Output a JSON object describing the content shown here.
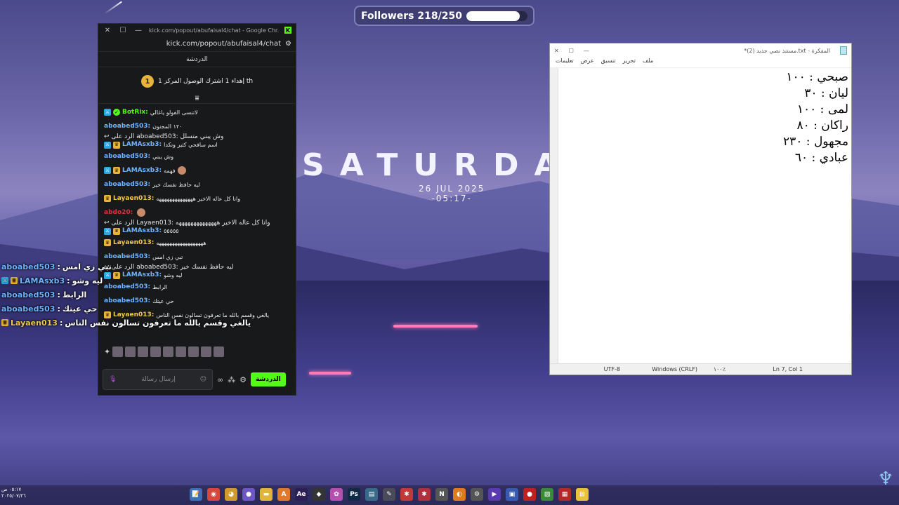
{
  "followers": {
    "label": "Followers 218/250",
    "current": 218,
    "goal": 250
  },
  "wallpaper": {
    "title": "SATURDA",
    "date": "26 JUL 2025",
    "time": "-05:17-"
  },
  "chat_window": {
    "title": "kick.com/popout/abufaisal4/chat - Google Chr...",
    "url": "kick.com/popout/abufaisal4/chat",
    "heading": "الدردشة",
    "pinned": {
      "rank": "1",
      "text": "إهداء 1 اشترك الوصول المركز 1 th"
    },
    "messages": [
      {
        "badges": [
          "mod",
          "verified"
        ],
        "user": "BotRix",
        "color": "#53fc18",
        "text": "لاتنسى الفولو ياغالي"
      },
      {
        "badges": [],
        "user": "aboabed503",
        "color": "#6fb3ff",
        "text": "١٢٠ المجنون"
      },
      {
        "badges": [
          "mod",
          "crown"
        ],
        "user": "LAMAsxb3",
        "color": "#6fb3ff",
        "reply": "الرد على aboabed503: وش يبني متسلل",
        "text": "اسم سافحي كثير ونكدا"
      },
      {
        "badges": [],
        "user": "aboabed503",
        "color": "#6fb3ff",
        "text": "وش يبني"
      },
      {
        "badges": [
          "mod",
          "crown"
        ],
        "user": "LAMAsxb3",
        "color": "#6fb3ff",
        "text": "فهمه",
        "emote": true
      },
      {
        "badges": [],
        "user": "aboabed503",
        "color": "#6fb3ff",
        "text": "ليه حافظ نفسك خير"
      },
      {
        "badges": [
          "crown"
        ],
        "user": "Layaen013",
        "color": "#f1c94a",
        "text": "وانا كل عاله الاخير ههههههههههههههه"
      },
      {
        "badges": [],
        "user": "abdo20",
        "color": "#e0313a",
        "text": "",
        "emote": true
      },
      {
        "badges": [
          "mod",
          "crown"
        ],
        "user": "LAMAsxb3",
        "color": "#6fb3ff",
        "reply": "الرد على Layaen013: وانا كل عاله الاخير ههههههههههههههه",
        "text": "٥٥٥٥٥"
      },
      {
        "badges": [
          "crown"
        ],
        "user": "Layaen013",
        "color": "#f1c94a",
        "text": "ههههههههههههههههههه"
      },
      {
        "badges": [],
        "user": "aboabed503",
        "color": "#6fb3ff",
        "text": "تبي زي امس"
      },
      {
        "badges": [
          "mod",
          "crown"
        ],
        "user": "LAMAsxb3",
        "color": "#6fb3ff",
        "reply": "الرد على aboabed503: ليه حافظ نفسك خير",
        "text": "ليه وشو"
      },
      {
        "badges": [],
        "user": "aboabed503",
        "color": "#6fb3ff",
        "text": "الرابط"
      },
      {
        "badges": [],
        "user": "aboabed503",
        "color": "#6fb3ff",
        "text": "حي عيتك"
      },
      {
        "badges": [
          "crown"
        ],
        "user": "Layaen013",
        "color": "#f1c94a",
        "text": "يالغي وقسم بالله ما تعرفون تسالون نفس الناس"
      }
    ],
    "input_placeholder": "إرسال رسالة",
    "send_label": "الدردشة"
  },
  "overlay_chat": [
    {
      "user": "aboabed503",
      "color": "#6fb3ff",
      "text": "تبي زي امس",
      "badges": []
    },
    {
      "user": "LAMAsxb3",
      "color": "#6fb3ff",
      "text": "ليه وشو",
      "badges": [
        "mod",
        "crown"
      ]
    },
    {
      "user": "aboabed503",
      "color": "#6fb3ff",
      "text": "الرابط",
      "badges": []
    },
    {
      "user": "aboabed503",
      "color": "#6fb3ff",
      "text": "حي عيتك",
      "badges": []
    },
    {
      "user": "Layaen013",
      "color": "#f1c94a",
      "text": "يالغي وقسم بالله ما تعرفون تسالون نفس الناس",
      "badges": [
        "crown"
      ]
    }
  ],
  "notepad": {
    "title": "*مستند نصي جديد (2).txt - المفكرة",
    "menu": [
      "ملف",
      "تحرير",
      "تنسيق",
      "عرض",
      "تعليمات"
    ],
    "lines": [
      "صبحي : ١٠٠",
      "ليان : ٣٠",
      "لمى : ١٠٠",
      "راكان : ٨٠",
      "مجهول : ٢٣٠",
      "عبادي : ٦٠"
    ],
    "status": {
      "encoding": "UTF-8",
      "line_ending": "Windows (CRLF)",
      "zoom": "١٠٠٪",
      "position": "Ln 7, Col 1"
    }
  },
  "taskbar": {
    "clock_time": "٠٥:١٧ ص",
    "clock_date": "٢٠٢٥/٠٧/٢٦",
    "icons": [
      {
        "name": "notepad-icon",
        "glyph": "📝",
        "color": "#3f6fb5"
      },
      {
        "name": "chrome-icon",
        "glyph": "◉",
        "color": "#d9463b"
      },
      {
        "name": "discord-icon",
        "glyph": "◕",
        "color": "#d09b2c"
      },
      {
        "name": "app-purple-icon",
        "glyph": "●",
        "color": "#6c57c4"
      },
      {
        "name": "folder-icon",
        "glyph": "▬",
        "color": "#e0b53a"
      },
      {
        "name": "a-app-icon",
        "glyph": "A",
        "color": "#e0792c"
      },
      {
        "name": "after-effects-icon",
        "glyph": "Ae",
        "color": "#2c1f58"
      },
      {
        "name": "obs-icon",
        "glyph": "◆",
        "color": "#343434"
      },
      {
        "name": "paint-icon",
        "glyph": "✿",
        "color": "#b54fb0"
      },
      {
        "name": "photoshop-icon",
        "glyph": "Ps",
        "color": "#0f2a45"
      },
      {
        "name": "app-teal-icon",
        "glyph": "▤",
        "color": "#3a6a8a"
      },
      {
        "name": "tool-icon",
        "glyph": "✎",
        "color": "#4a4a5a"
      },
      {
        "name": "app-red-icon",
        "glyph": "✱",
        "color": "#c03a3a"
      },
      {
        "name": "app-red2-icon",
        "glyph": "✱",
        "color": "#b03040"
      },
      {
        "name": "n-app-icon",
        "glyph": "N",
        "color": "#555"
      },
      {
        "name": "blender-icon",
        "glyph": "◐",
        "color": "#e07a1c"
      },
      {
        "name": "app-gray-icon",
        "glyph": "⚙",
        "color": "#555"
      },
      {
        "name": "video-icon",
        "glyph": "▶",
        "color": "#5a3ab0"
      },
      {
        "name": "app-blue-icon",
        "glyph": "▣",
        "color": "#3a5ab0"
      },
      {
        "name": "record-icon",
        "glyph": "●",
        "color": "#c02020"
      },
      {
        "name": "app-green-icon",
        "glyph": "▧",
        "color": "#3a8a3a"
      },
      {
        "name": "app-image-icon",
        "glyph": "▦",
        "color": "#b02a2a"
      },
      {
        "name": "windows-icon",
        "glyph": "⊞",
        "color": "#e8c23a"
      }
    ]
  }
}
